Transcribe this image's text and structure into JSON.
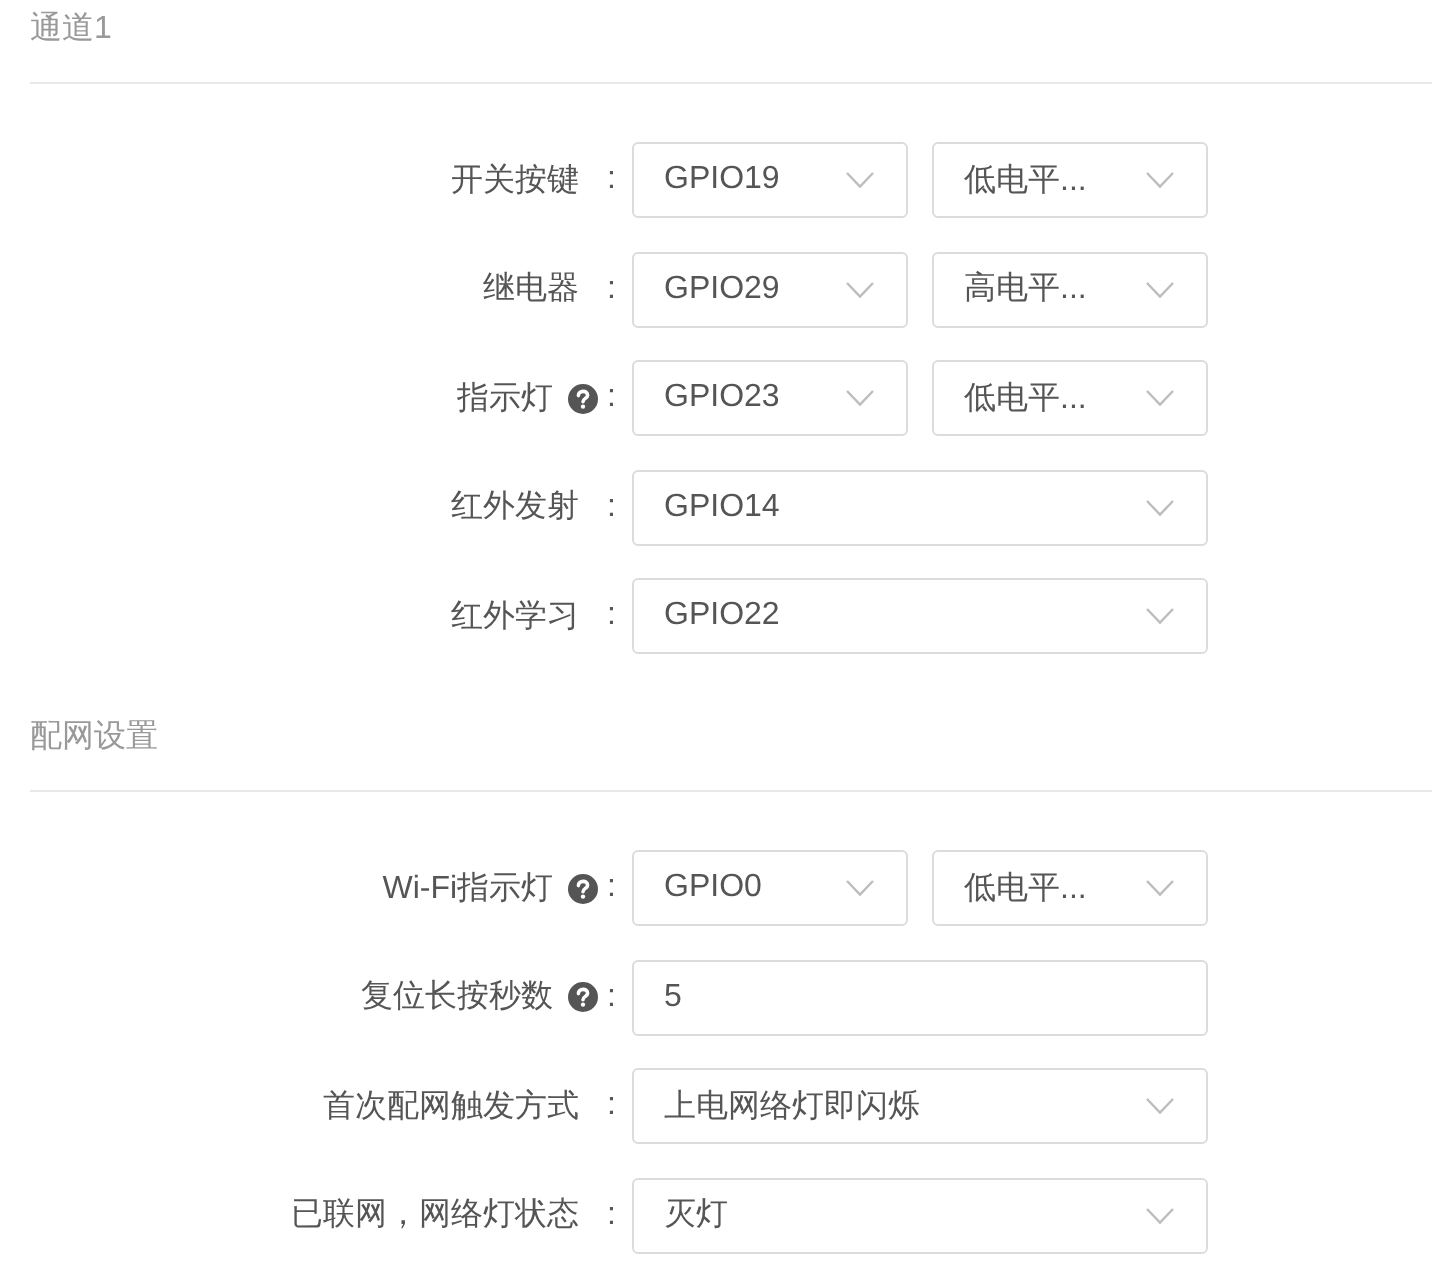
{
  "sections": [
    {
      "title": "通道1",
      "rows": [
        {
          "label": "开关按键",
          "help": false,
          "colon": ":",
          "controls": [
            {
              "kind": "select",
              "value": "GPIO19"
            },
            {
              "kind": "select",
              "value": "低电平..."
            }
          ]
        },
        {
          "label": "继电器",
          "help": false,
          "colon": ":",
          "controls": [
            {
              "kind": "select",
              "value": "GPIO29"
            },
            {
              "kind": "select",
              "value": "高电平..."
            }
          ]
        },
        {
          "label": "指示灯",
          "help": true,
          "colon": ":",
          "controls": [
            {
              "kind": "select",
              "value": "GPIO23"
            },
            {
              "kind": "select",
              "value": "低电平..."
            }
          ]
        },
        {
          "label": "红外发射",
          "help": false,
          "colon": ":",
          "controls": [
            {
              "kind": "select",
              "value": "GPIO14"
            }
          ]
        },
        {
          "label": "红外学习",
          "help": false,
          "colon": ":",
          "controls": [
            {
              "kind": "select",
              "value": "GPIO22"
            }
          ]
        }
      ]
    },
    {
      "title": "配网设置",
      "rows": [
        {
          "label": "Wi-Fi指示灯",
          "help": true,
          "colon": ":",
          "controls": [
            {
              "kind": "select",
              "value": "GPIO0"
            },
            {
              "kind": "select",
              "value": "低电平..."
            }
          ]
        },
        {
          "label": "复位长按秒数",
          "help": true,
          "colon": ":",
          "controls": [
            {
              "kind": "input",
              "value": "5"
            }
          ]
        },
        {
          "label": "首次配网触发方式",
          "help": false,
          "colon": ":",
          "controls": [
            {
              "kind": "select",
              "value": "上电网络灯即闪烁"
            }
          ]
        },
        {
          "label": "已联网，网络灯状态",
          "help": false,
          "colon": ":",
          "controls": [
            {
              "kind": "select",
              "value": "灭灯"
            }
          ]
        }
      ]
    }
  ]
}
